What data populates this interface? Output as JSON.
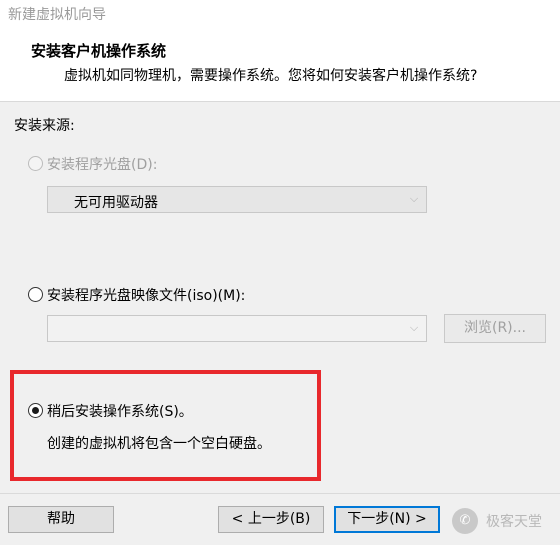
{
  "window": {
    "title": "新建虚拟机向导"
  },
  "header": {
    "title": "安装客户机操作系统",
    "subtitle": "虚拟机如同物理机，需要操作系统。您将如何安装客户机操作系统?"
  },
  "install_source": {
    "label": "安装来源:",
    "disc_option": {
      "label": "安装程序光盘(D):",
      "selected": false,
      "enabled": false,
      "drive_select_value": "无可用驱动器"
    },
    "iso_option": {
      "label": "安装程序光盘映像文件(iso)(M):",
      "selected": false,
      "path_value": "",
      "browse_label": "浏览(R)..."
    },
    "later_option": {
      "label": "稍后安装操作系统(S)。",
      "selected": true,
      "description": "创建的虚拟机将包含一个空白硬盘。"
    }
  },
  "footer": {
    "help_label": "帮助",
    "back_label": "< 上一步(B)",
    "next_label": "下一步(N) >"
  },
  "watermark": {
    "icon": "wechat-icon",
    "text": "极客天堂"
  },
  "colors": {
    "highlight": "#e8282c",
    "focus": "#0078d7"
  }
}
